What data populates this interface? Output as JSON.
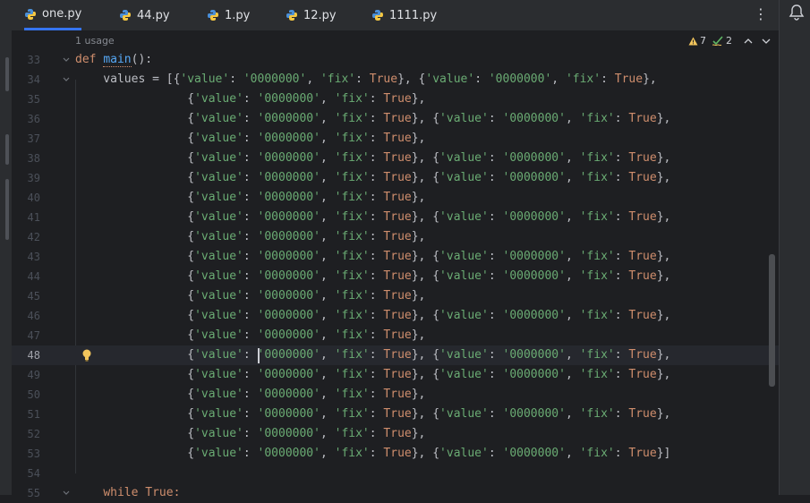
{
  "tabs": [
    {
      "label": "one.py",
      "active": true
    },
    {
      "label": "44.py",
      "active": false
    },
    {
      "label": "1.py",
      "active": false
    },
    {
      "label": "12.py",
      "active": false
    },
    {
      "label": "1111.py",
      "active": false
    }
  ],
  "menu_glyph": "⋮",
  "editor": {
    "usage_hint": "1 usage",
    "warnings_count": "7",
    "weak_warnings_count": "2",
    "current_line": "48",
    "lines": [
      {
        "num": "33"
      },
      {
        "num": "34"
      },
      {
        "num": "35"
      },
      {
        "num": "36"
      },
      {
        "num": "37"
      },
      {
        "num": "38"
      },
      {
        "num": "39"
      },
      {
        "num": "40"
      },
      {
        "num": "41"
      },
      {
        "num": "42"
      },
      {
        "num": "43"
      },
      {
        "num": "44"
      },
      {
        "num": "45"
      },
      {
        "num": "46"
      },
      {
        "num": "47"
      },
      {
        "num": "48"
      },
      {
        "num": "49"
      },
      {
        "num": "50"
      },
      {
        "num": "51"
      },
      {
        "num": "52"
      },
      {
        "num": "53"
      },
      {
        "num": "54"
      },
      {
        "num": "55"
      }
    ],
    "code": {
      "def_keyword": "def",
      "func_name": "main",
      "func_tail": "():",
      "values_assign": "    values = [",
      "dict_open": "{",
      "key_value": "'value'",
      "colon": ": ",
      "str_value": "'0000000'",
      "comma": ", ",
      "key_fix": "'fix'",
      "true_kw": "True",
      "dict_close": "}",
      "while_kw": "while",
      "while_true": "True:",
      "closing_bracket": "]"
    }
  },
  "colors": {
    "keyword": "#cf8e6d",
    "string": "#6aab73",
    "function": "#56a8f5",
    "background": "#1e1f22",
    "accent": "#3574f0"
  }
}
